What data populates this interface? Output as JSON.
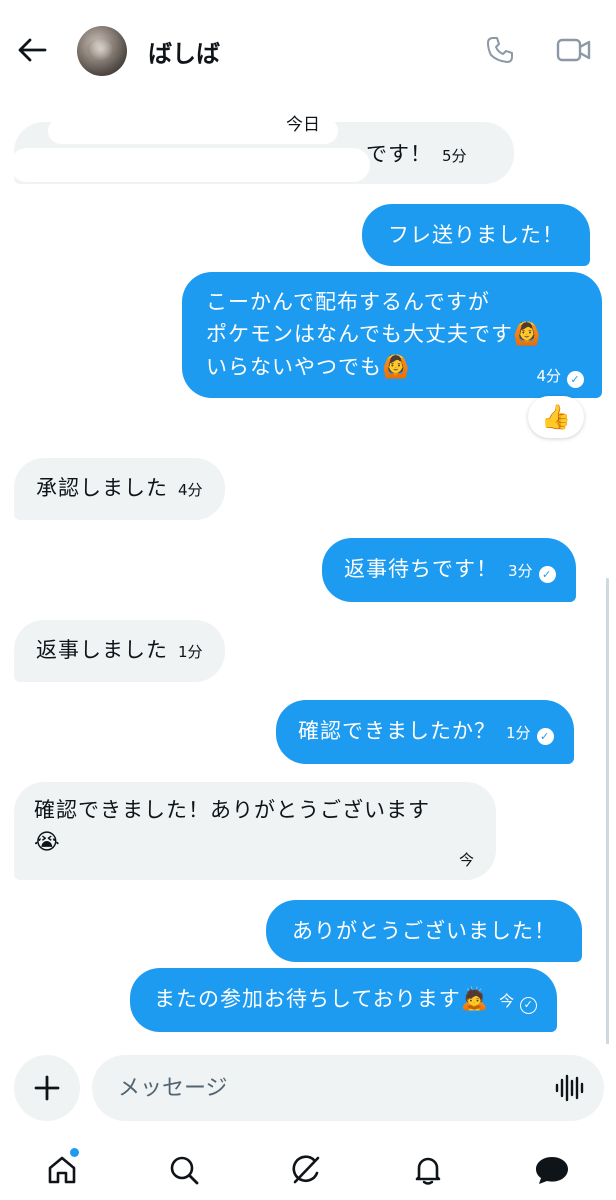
{
  "header": {
    "contact_name": "ばしば"
  },
  "messages": {
    "m1_visible_tail": "です！",
    "m1_time": "5分",
    "m2": {
      "text": "フレ送りました！"
    },
    "m3": {
      "line1": "こーかんで配布するんですが",
      "line2": "ポケモンはなんでも大丈夫です",
      "line3": "いらないやつでも",
      "emoji": "🙆",
      "time": "4分",
      "reaction": "👍"
    },
    "m4": {
      "text": "承認しました",
      "time": "4分"
    },
    "m5": {
      "text": "返事待ちです！",
      "time": "3分"
    },
    "m6": {
      "text": "返事しました",
      "time": "1分"
    },
    "m7": {
      "text": "確認できましたか？",
      "time": "1分"
    },
    "m8": {
      "text": "確認できました！ありがとうございます",
      "emoji": "😭",
      "time": "今"
    },
    "m9": {
      "text": "ありがとうございました！"
    },
    "m10": {
      "text": "またの参加お待ちしております",
      "emoji": "🙇",
      "time": "今"
    }
  },
  "composer": {
    "placeholder": "メッセージ"
  },
  "colors": {
    "accent": "#1d9bf0",
    "incoming_bubble": "#eff3f4",
    "text": "#0f1419"
  },
  "icons": [
    "back-arrow-icon",
    "phone-icon",
    "video-icon",
    "plus-icon",
    "voice-waveform-icon",
    "home-icon",
    "search-icon",
    "grok-icon",
    "bell-icon",
    "messages-icon"
  ]
}
